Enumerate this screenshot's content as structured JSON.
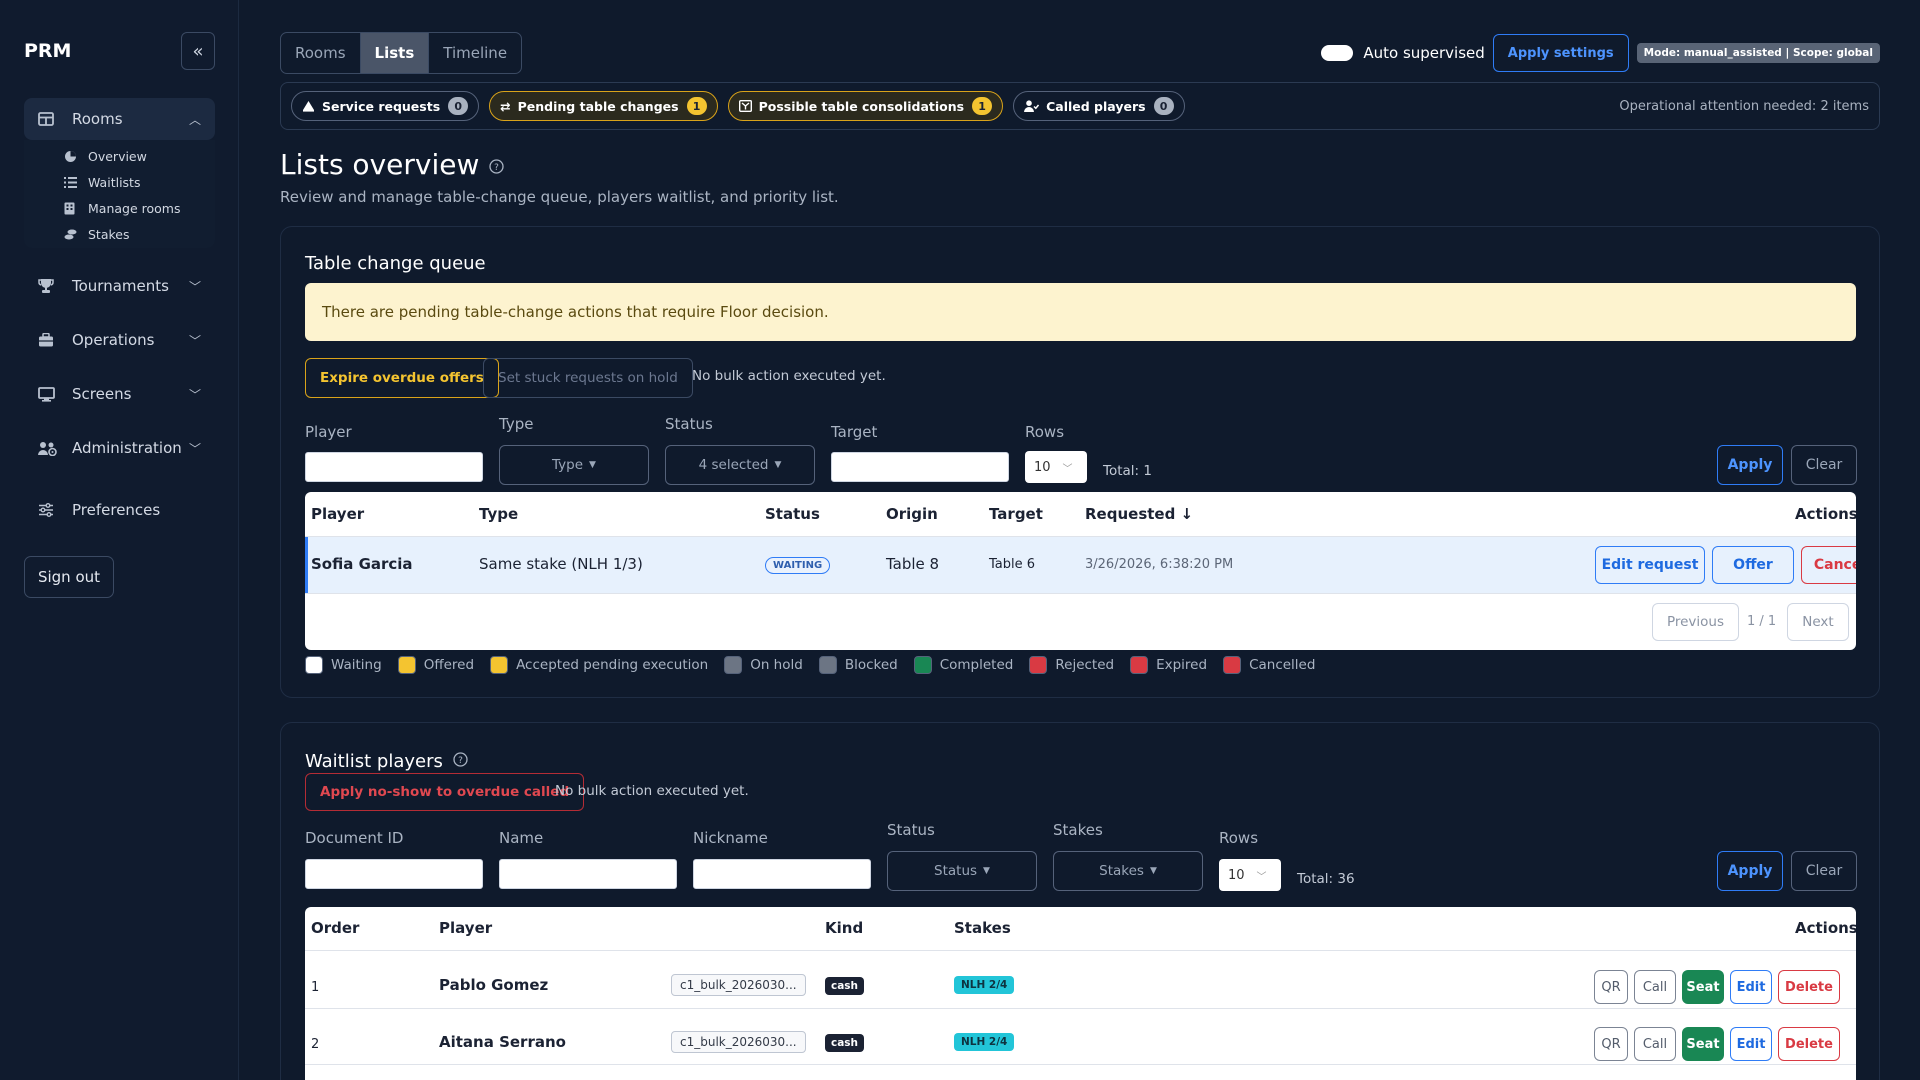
{
  "sidebar": {
    "brand": "PRM",
    "nav": {
      "rooms": "Rooms",
      "tournaments": "Tournaments",
      "operations": "Operations",
      "screens": "Screens",
      "administration": "Administration",
      "preferences": "Preferences"
    },
    "rooms_sub": [
      "Overview",
      "Waitlists",
      "Manage rooms",
      "Stakes"
    ],
    "signout": "Sign out"
  },
  "tabs": [
    "Rooms",
    "Lists",
    "Timeline"
  ],
  "topbar": {
    "auto_supervised": "Auto supervised",
    "apply_settings": "Apply settings",
    "mode": "Mode: manual_assisted | Scope: global"
  },
  "alerts": {
    "chips": [
      {
        "label": "Service requests",
        "count": "0"
      },
      {
        "label": "Pending table changes",
        "count": "1"
      },
      {
        "label": "Possible table consolidations",
        "count": "1"
      },
      {
        "label": "Called players",
        "count": "0"
      }
    ],
    "attention": "Operational attention needed: 2 items"
  },
  "page": {
    "title": "Lists overview",
    "subtitle": "Review and manage table-change queue, players waitlist, and priority list."
  },
  "queue": {
    "title": "Table change queue",
    "warning": "There are pending table-change actions that require Floor decision.",
    "expire_btn": "Expire overdue offers",
    "hold_btn": "Set stuck requests on hold",
    "bulk_note": "No bulk action executed yet.",
    "filters": {
      "player": "Player",
      "type": "Type",
      "type_value": "Type",
      "status": "Status",
      "status_value": "4 selected",
      "target": "Target",
      "rows": "Rows",
      "rows_value": "10",
      "total": "Total: 1",
      "apply": "Apply",
      "clear": "Clear"
    },
    "headers": {
      "player": "Player",
      "type": "Type",
      "status": "Status",
      "origin": "Origin",
      "target": "Target",
      "requested": "Requested ↓",
      "actions": "Actions"
    },
    "row": {
      "player": "Sofia Garcia",
      "type": "Same stake (NLH 1/3)",
      "status": "WAITING",
      "origin": "Table 8",
      "target": "Table 6",
      "requested": "3/26/2026, 6:38:20 PM",
      "edit": "Edit request",
      "offer": "Offer",
      "cancel": "Cancel"
    },
    "pagination": {
      "previous": "Previous",
      "info": "1 / 1",
      "next": "Next"
    },
    "legend": [
      {
        "label": "Waiting",
        "color": "#ffffff"
      },
      {
        "label": "Offered",
        "color": "#f4c430"
      },
      {
        "label": "Accepted pending execution",
        "color": "#f4c430"
      },
      {
        "label": "On hold",
        "color": "#6c7584"
      },
      {
        "label": "Blocked",
        "color": "#6c7584"
      },
      {
        "label": "Completed",
        "color": "#198754"
      },
      {
        "label": "Rejected",
        "color": "#d93a43"
      },
      {
        "label": "Expired",
        "color": "#d93a43"
      },
      {
        "label": "Cancelled",
        "color": "#d93a43"
      }
    ]
  },
  "waitlist": {
    "title": "Waitlist players",
    "noshow_btn": "Apply no-show to overdue called",
    "bulk_note": "No bulk action executed yet.",
    "filters": {
      "document_id": "Document ID",
      "name": "Name",
      "nickname": "Nickname",
      "status": "Status",
      "status_value": "Status",
      "stakes": "Stakes",
      "stakes_value": "Stakes",
      "rows": "Rows",
      "rows_value": "10",
      "total": "Total: 36",
      "apply": "Apply",
      "clear": "Clear"
    },
    "headers": {
      "order": "Order",
      "player": "Player",
      "kind": "Kind",
      "stakes": "Stakes",
      "actions": "Actions"
    },
    "rows": [
      {
        "order": "1",
        "player": "Pablo Gomez",
        "doc": "c1_bulk_2026030...",
        "kind": "cash",
        "stakes": "NLH 2/4"
      },
      {
        "order": "2",
        "player": "Aitana Serrano",
        "doc": "c1_bulk_2026030...",
        "kind": "cash",
        "stakes": "NLH 2/4"
      }
    ],
    "row_actions": {
      "qr": "QR",
      "call": "Call",
      "seat": "Seat",
      "edit": "Edit",
      "delete": "Delete"
    }
  }
}
